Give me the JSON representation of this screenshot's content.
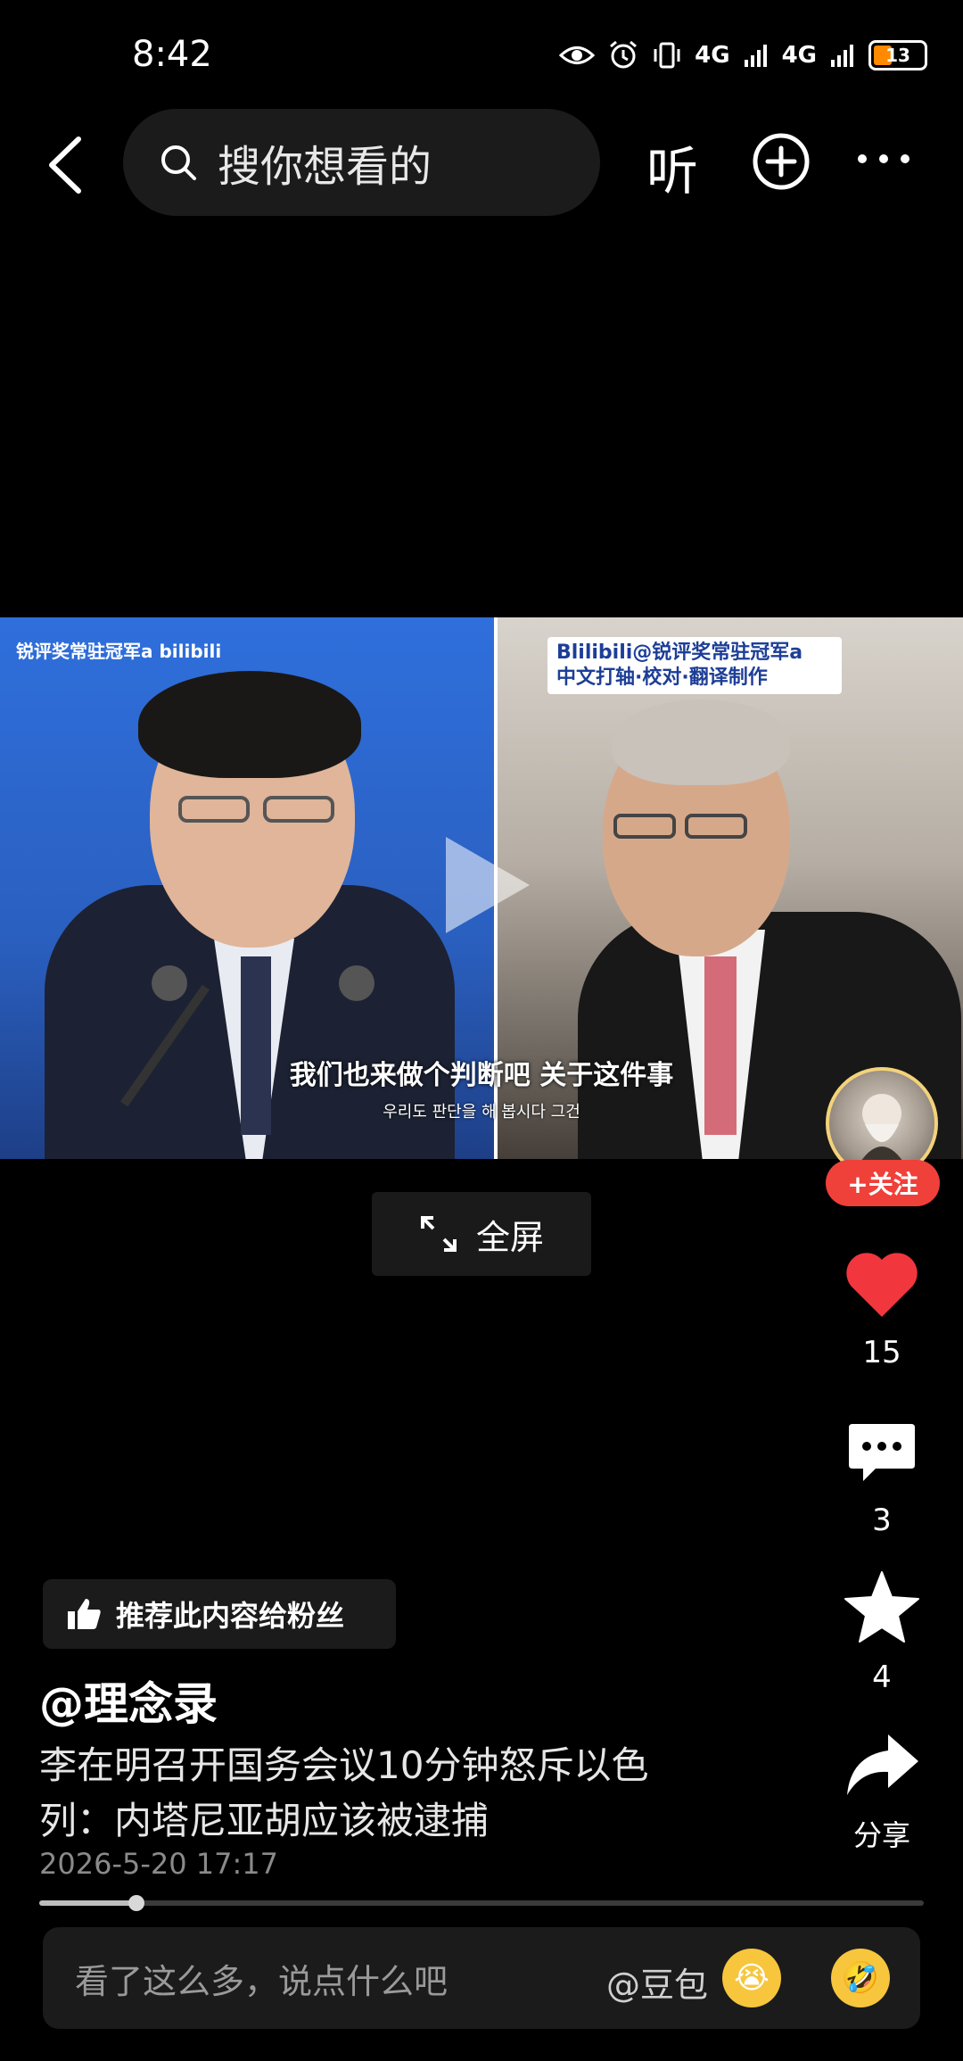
{
  "status_bar": {
    "time": "8:42",
    "signal1": "4G",
    "signal2": "4G",
    "battery": "13"
  },
  "nav": {
    "search_placeholder": "搜你想看的",
    "listen_label": "听"
  },
  "video": {
    "watermark_left": "锐评奖常驻冠军a bilibili",
    "watermark_right_line1": "Blilibili@锐评奖常驻冠军a",
    "watermark_right_line2": "中文打轴·校对·翻译制作",
    "subtitle_cn": "我们也来做个判断吧 关于这件事",
    "subtitle_ko": "우리도 판단을 해 봅시다 그건"
  },
  "author_badge": {
    "follow_label": "+关注"
  },
  "fullscreen_label": "全屏",
  "actions": {
    "likes": "15",
    "comments": "3",
    "favorites": "4",
    "share_label": "分享"
  },
  "recommend_label": "推荐此内容给粉丝",
  "post": {
    "author": "@理念录",
    "title": "李在明召开国务会议10分钟怒斥以色列：内塔尼亚胡应该被逮捕",
    "date": "2026-5-20 17:17"
  },
  "progress": {
    "fraction": 0.11
  },
  "comment_bar": {
    "placeholder": "看了这么多，说点什么吧",
    "mention": "@豆包",
    "emoji1": "😭",
    "emoji2": "🤣"
  },
  "colors": {
    "accent_red": "#f0403a",
    "like_red": "#f2363e"
  }
}
